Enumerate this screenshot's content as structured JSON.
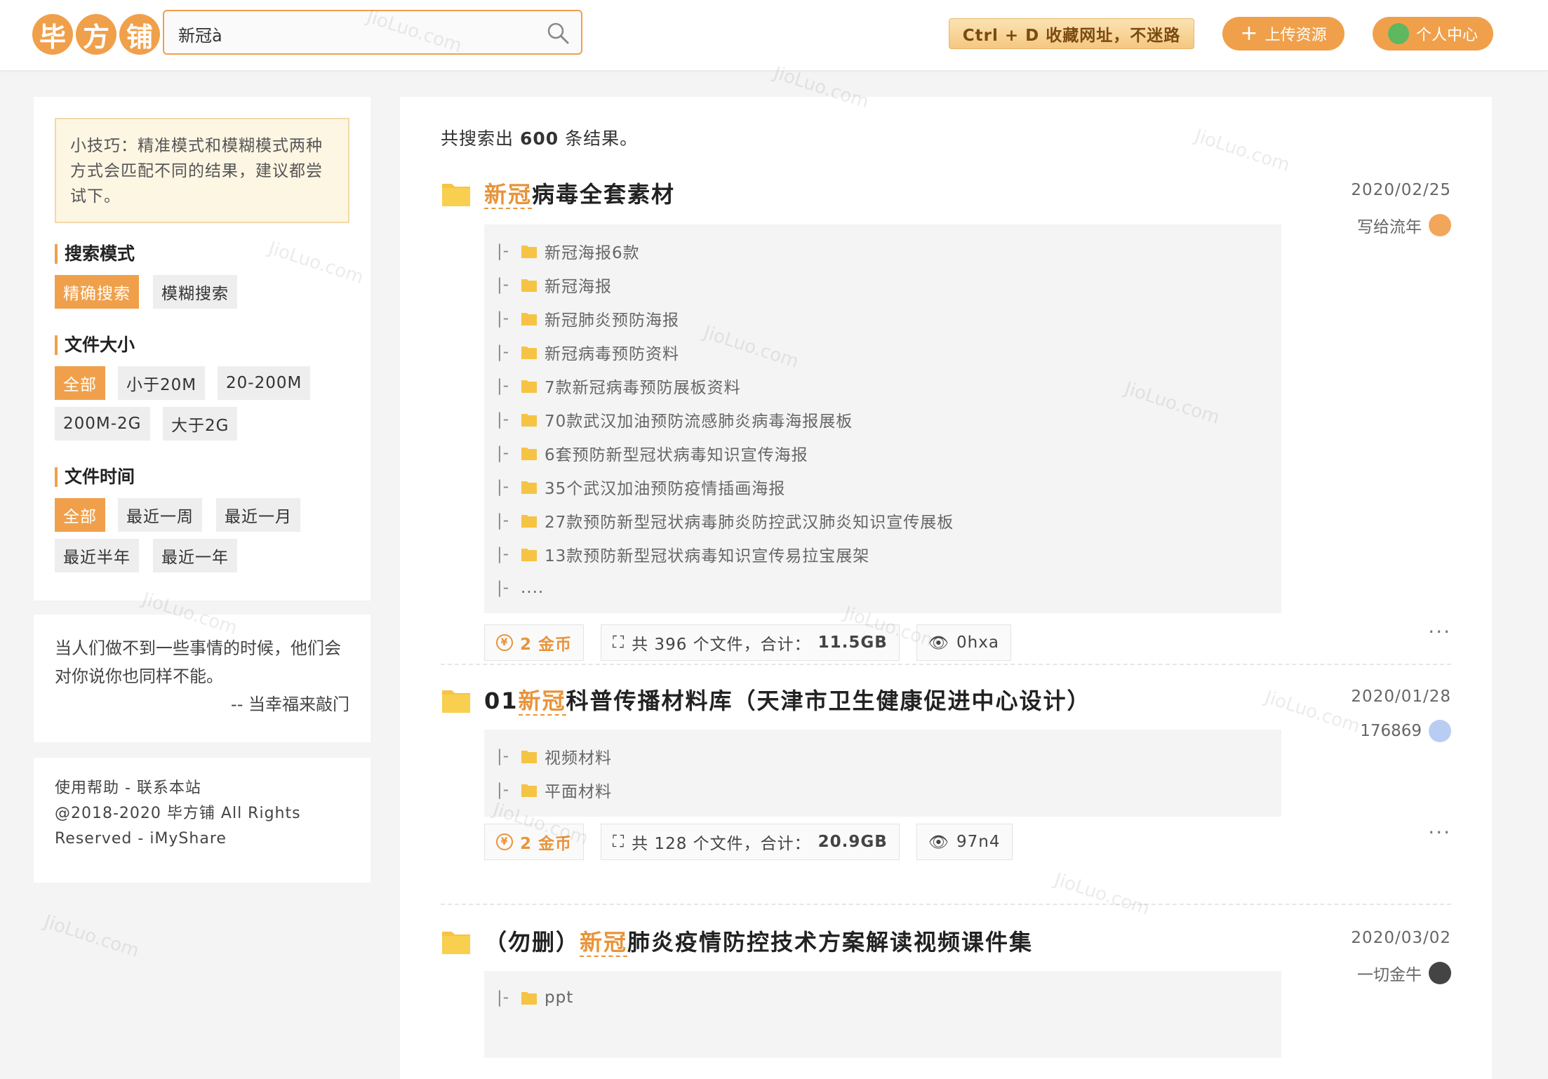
{
  "header": {
    "logo_chars": [
      "毕",
      "方",
      "铺"
    ],
    "search_value": "新冠à",
    "bookmark_tip": "Ctrl + D 收藏网址，不迷路",
    "upload_label": "上传资源",
    "user_label": "个人中心",
    "accent": "#f0a04b"
  },
  "sidebar": {
    "tip": "小技巧：精准模式和模糊模式两种方式会匹配不同的结果，建议都尝试下。",
    "search_mode": {
      "heading": "搜索模式",
      "options": [
        "精确搜索",
        "模糊搜索"
      ],
      "active": 0
    },
    "file_size": {
      "heading": "文件大小",
      "options": [
        "全部",
        "小于20M",
        "20-200M",
        "200M-2G",
        "大于2G"
      ],
      "active": 0
    },
    "file_time": {
      "heading": "文件时间",
      "options": [
        "全部",
        "最近一周",
        "最近一月",
        "最近半年",
        "最近一年"
      ],
      "active": 0
    },
    "quote": "当人们做不到一些事情的时候，他们会对你说你也同样不能。",
    "quote_author": "-- 当幸福来敲门",
    "footer_links": "使用帮助 - 联系本站",
    "copyright": "@2018-2020 毕方铺 All Rights Reserved - iMyShare"
  },
  "results": {
    "count_prefix": "共搜索出",
    "count": "600",
    "count_suffix": "条结果。",
    "items": [
      {
        "title_highlight": "新冠",
        "title_rest": "病毒全套素材",
        "title_prefix": "",
        "date": "2020/02/25",
        "author": "写给流年",
        "tree": [
          "新冠海报6款",
          "新冠海报",
          "新冠肺炎预防海报",
          "新冠病毒预防资料",
          "7款新冠病毒预防展板资料",
          "70款武汉加油预防流感肺炎病毒海报展板",
          "6套预防新型冠状病毒知识宣传海报",
          "35个武汉加油预防疫情插画海报",
          "27款预防新型冠状病毒肺炎防控武汉肺炎知识宣传展板",
          "13款预防新型冠状病毒知识宣传易拉宝展架",
          "...."
        ],
        "coins": "2 金币",
        "files": "共 396 个文件，合计：",
        "size": "11.5GB",
        "views": "0hxa"
      },
      {
        "title_prefix": "01",
        "title_highlight": "新冠",
        "title_rest": "科普传播材料库（天津市卫生健康促进中心设计）",
        "date": "2020/01/28",
        "author": "176869",
        "tree": [
          "视频材料",
          "平面材料"
        ],
        "coins": "2 金币",
        "files": "共 128 个文件，合计：",
        "size": "20.9GB",
        "views": "97n4"
      },
      {
        "title_prefix": "（勿删）",
        "title_highlight": "新冠",
        "title_rest": "肺炎疫情防控技术方案解读视频课件集",
        "date": "2020/03/02",
        "author": "一切金牛",
        "tree": [
          "ppt"
        ]
      }
    ]
  },
  "watermark": "JioLuo.com"
}
